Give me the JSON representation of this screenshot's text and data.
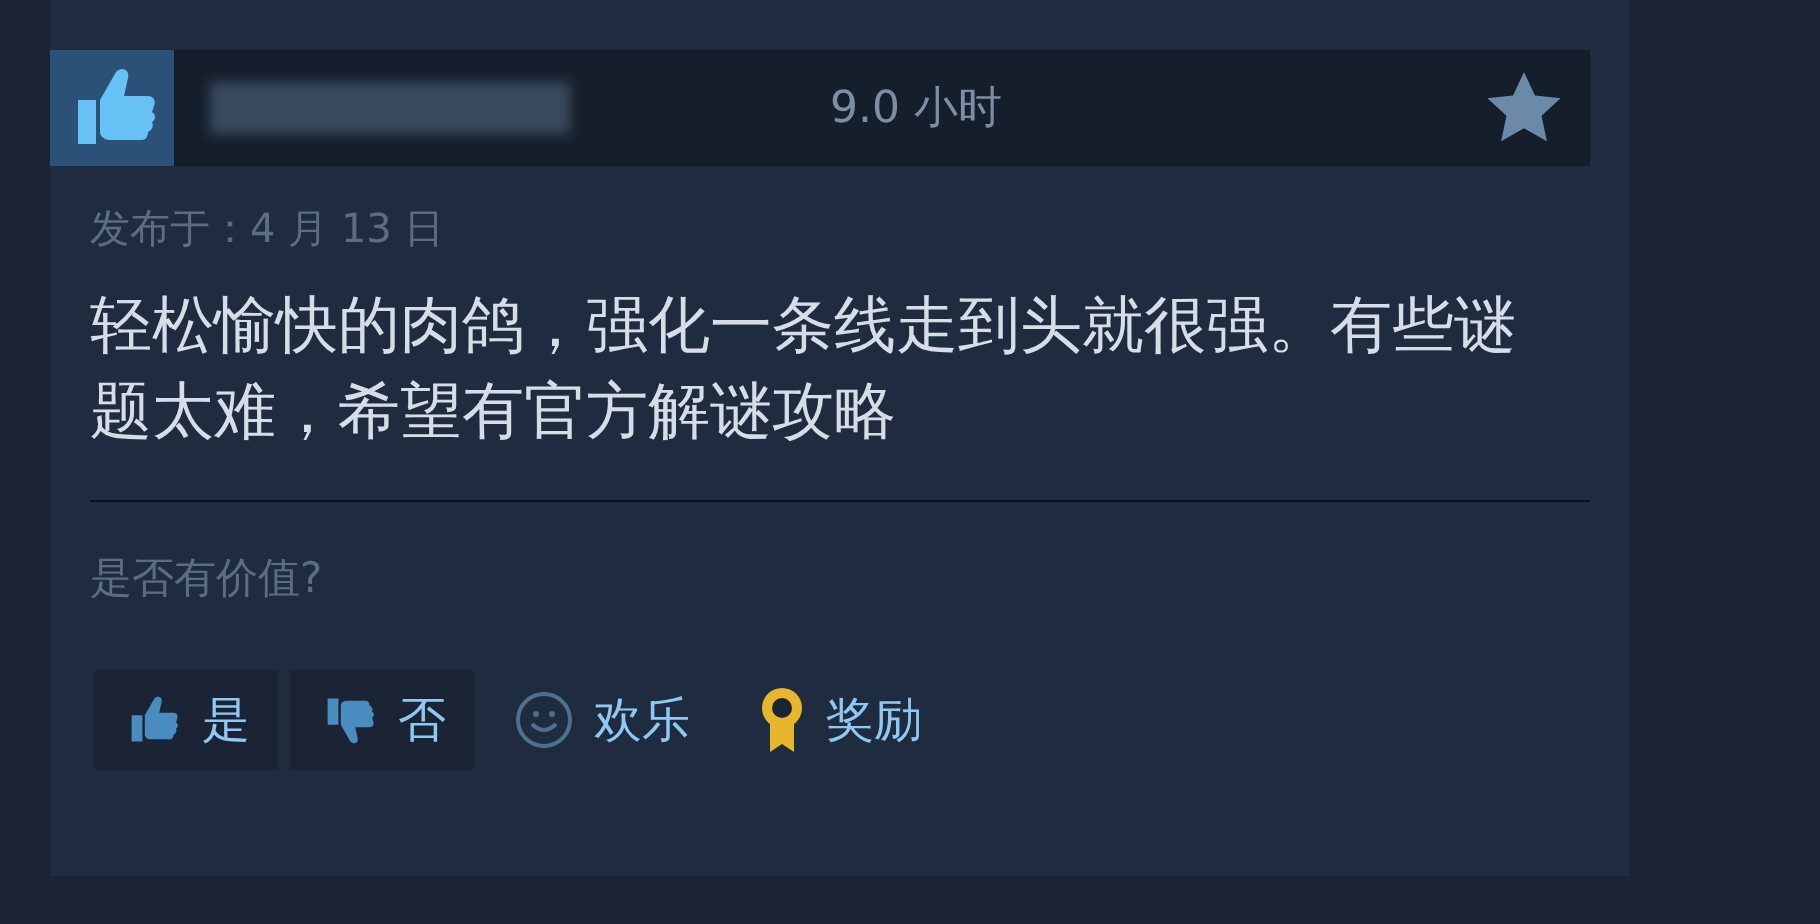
{
  "review": {
    "hours": "9.0 小时",
    "posted": "发布于：4 月 13 日",
    "text": "轻松愉快的肉鸽，强化一条线走到头就很强。有些谜题太难，希望有官方解谜攻略"
  },
  "helpful": {
    "question": "是否有价值?",
    "buttons": [
      {
        "kind": "yes",
        "label": "是"
      },
      {
        "kind": "no",
        "label": "否"
      },
      {
        "kind": "funny",
        "label": "欢乐"
      },
      {
        "kind": "award",
        "label": "奖励"
      }
    ]
  }
}
